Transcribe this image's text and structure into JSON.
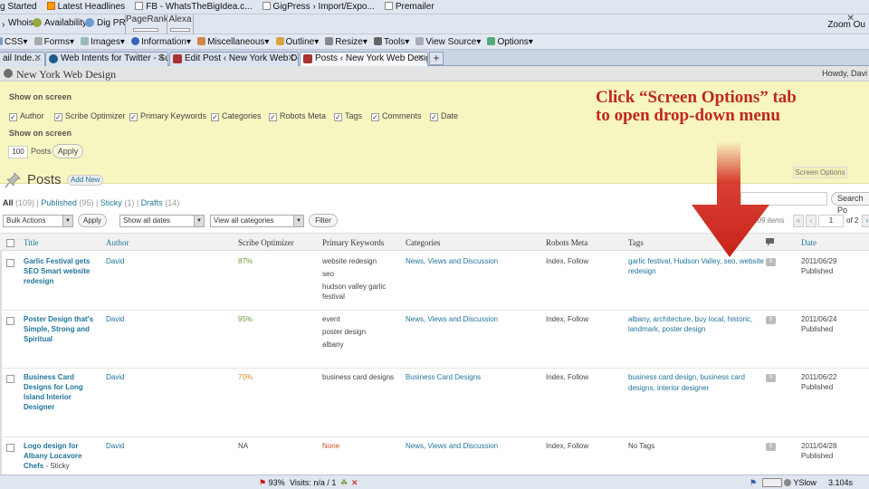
{
  "bookmarks": [
    "g Started",
    "Latest Headlines",
    "FB - WhatsTheBigIdea.c...",
    "GigPress › Import/Expo...",
    "Premailer"
  ],
  "seo_toolbar": {
    "whois": "Whois",
    "availability": "Availability",
    "dig_pr": "Dig PR",
    "pagerank": "PageRank",
    "alexa": "Alexa",
    "zoom_out": "Zoom Ou",
    "close": "✕"
  },
  "webdev_toolbar": [
    "CSS▾",
    "Forms▾",
    "Images▾",
    "Information▾",
    "Miscellaneous▾",
    "Outline▾",
    "Resize▾",
    "Tools▾",
    "View Source▾",
    "Options▾"
  ],
  "tabs": [
    {
      "label": "ail Inde..."
    },
    {
      "label": "Web Intents for Twitter - Sup..."
    },
    {
      "label": "Edit Post ‹ New York Web De..."
    },
    {
      "label": "Posts ‹ New York Web Design..."
    }
  ],
  "tab_plus": "+",
  "wp_header": {
    "site_name": "New York Web Design",
    "howdy": "Howdy, Davi"
  },
  "screen_options": {
    "heading1": "Show on screen",
    "checkboxes": [
      "Author",
      "Scribe Optimizer",
      "Primary Keywords",
      "Categories",
      "Robots Meta",
      "Tags",
      "Comments",
      "Date"
    ],
    "check_mark": "✓",
    "heading2": "Show on screen",
    "per_page": "100",
    "posts_label": "Posts",
    "apply": "Apply",
    "tab_label": "Screen Options"
  },
  "callout": {
    "line1": "Click “Screen Options” tab",
    "line2": "to open drop-down menu"
  },
  "colors": {
    "callout": "#c0281e",
    "arrow": "#d42a1e",
    "link": "#21759b",
    "panel": "#f7f6c0"
  },
  "page": {
    "title": "Posts",
    "add_new": "Add New"
  },
  "subsubsub": {
    "all": "All",
    "all_count": "(109)",
    "sep1": " | ",
    "published": "Published",
    "published_count": "(95)",
    "sep2": " | ",
    "sticky": "Sticky",
    "sticky_count": "(1)",
    "sep3": " | ",
    "drafts": "Drafts",
    "drafts_count": "(14)"
  },
  "search_button": "Search Po",
  "filters": {
    "bulk": "Bulk Actions",
    "apply": "Apply",
    "dates": "Show all dates",
    "cats": "View all categories",
    "filter": "Filter",
    "dropdown_arrow": "▼"
  },
  "pagination": {
    "items": "109 items",
    "first": "«",
    "prev": "‹",
    "page": "1",
    "of": "of 2",
    "next": "›"
  },
  "columns": [
    "Title",
    "Author",
    "Scribe Optimizer",
    "Primary Keywords",
    "Categories",
    "Robots Meta",
    "Tags",
    "Date"
  ],
  "rows": [
    {
      "title": [
        "Garlic Festival gets",
        "SEO Smart website",
        "redesign"
      ],
      "sticky": "",
      "author": "David",
      "scribe": "87%",
      "keywords": [
        "website redesign",
        "seo",
        "hudson valley garlic festival"
      ],
      "categories": "News, Views and Discussion",
      "robots": "Index, Follow",
      "tags": [
        "garlic festival, Hudson Valley, seo, website",
        "redesign"
      ],
      "comments": "0",
      "date": "2011/06/29",
      "status": "Published"
    },
    {
      "title": [
        "Poster Design that's",
        "Simple, Strong and",
        "Spiritual"
      ],
      "sticky": "",
      "author": "David",
      "scribe": "95%",
      "keywords": [
        "event",
        "poster design",
        "albany"
      ],
      "categories": "News, Views and Discussion",
      "robots": "Index, Follow",
      "tags": [
        "albany, architecture, buy local, historic,",
        "landmark, poster design"
      ],
      "comments": "0",
      "date": "2011/06/24",
      "status": "Published"
    },
    {
      "title": [
        "Business Card",
        "Designs for Long",
        "Island Interior",
        "Designer"
      ],
      "sticky": "",
      "author": "David",
      "scribe": "70%",
      "keywords": [
        "business card designs"
      ],
      "categories": "Business Card Designs",
      "robots": "Index, Follow",
      "tags": [
        "business card design, business card",
        "designs, interior designer"
      ],
      "comments": "0",
      "date": "2011/06/22",
      "status": "Published"
    },
    {
      "title": [
        "Logo design for",
        "Albany Locavore",
        "Chefs"
      ],
      "sticky": " - Sticky",
      "author": "David",
      "scribe": "NA",
      "keywords": [
        "None"
      ],
      "categories": "News, Views and Discussion",
      "robots": "Index, Follow",
      "tags": [
        "No Tags"
      ],
      "comments": "0",
      "date": "2011/04/28",
      "status": "Published"
    }
  ],
  "status_bar": {
    "zoom": "93%",
    "visits": "Visits: n/a / 1",
    "yslow": "YSlow",
    "time": "3.104s"
  }
}
